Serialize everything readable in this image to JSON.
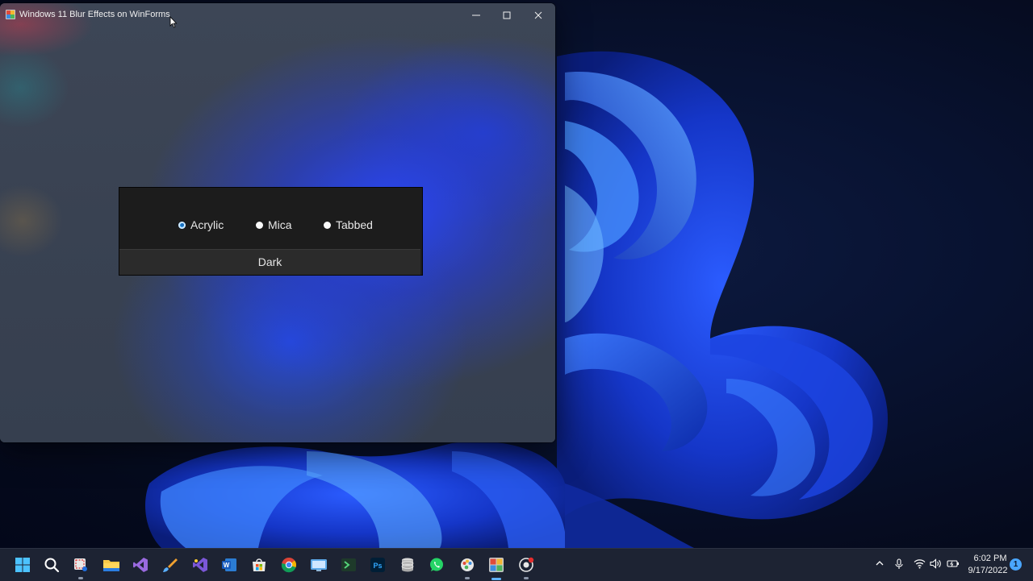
{
  "window": {
    "title": "Windows 11 Blur Effects on WinForms",
    "minimize_label": "Minimize",
    "maximize_label": "Maximize",
    "close_label": "Close"
  },
  "panel": {
    "radios": [
      {
        "label": "Acrylic",
        "checked": true
      },
      {
        "label": "Mica",
        "checked": false
      },
      {
        "label": "Tabbed",
        "checked": false
      }
    ],
    "theme_button_label": "Dark"
  },
  "taskbar": {
    "icons": [
      "windows-start-icon",
      "search-icon",
      "snipping-tool-icon",
      "file-explorer-icon",
      "visual-studio-icon",
      "paint-brush-icon",
      "visual-studio-preview-icon",
      "word-icon",
      "microsoft-store-icon",
      "chrome-icon",
      "remote-desktop-icon",
      "terminal-icon",
      "photoshop-icon",
      "database-icon",
      "whatsapp-icon",
      "paint-app-icon",
      "winforms-app-icon",
      "recorder-icon"
    ],
    "tray": {
      "time": "6:02 PM",
      "date": "9/17/2022",
      "notification_count": "1"
    }
  },
  "colors": {
    "accent": "#1f8fe0",
    "panel_bg": "#1c1c1c",
    "button_bg": "#2b2b2b",
    "taskbar_bg": "#1d2333"
  }
}
